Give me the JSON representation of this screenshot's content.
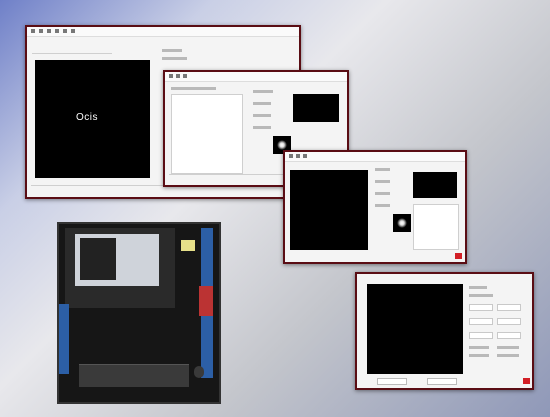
{
  "window1": {
    "logo_text": "Ocis"
  },
  "colors": {
    "frame": "#5a0d14",
    "close_button": "#d21f26",
    "photo_bg": "#1a1a1a"
  }
}
